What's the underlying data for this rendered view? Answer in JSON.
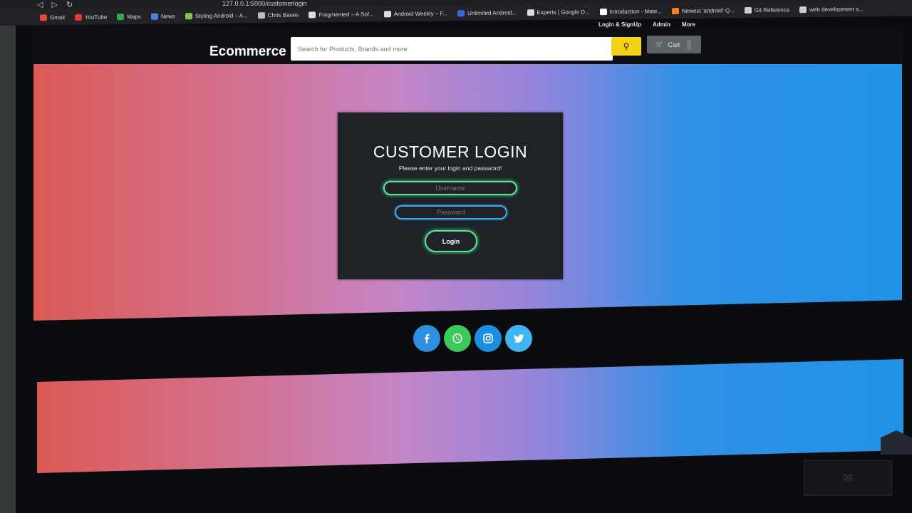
{
  "browser": {
    "address": "127.0.0.1:5000/customerlogin",
    "bookmarks": [
      {
        "label": "Gmail",
        "color": "#e04b3c"
      },
      {
        "label": "YouTube",
        "color": "#e53935"
      },
      {
        "label": "Maps",
        "color": "#34a853"
      },
      {
        "label": "News",
        "color": "#4a7fe0"
      },
      {
        "label": "Styling Android – A...",
        "color": "#8bc34a"
      },
      {
        "label": "Chris Banes",
        "color": "#bbbbbb"
      },
      {
        "label": "Fragmented – A Sof...",
        "color": "#dddddd"
      },
      {
        "label": "Android Weekly – F...",
        "color": "#dddddd"
      },
      {
        "label": "Unlimited Android...",
        "color": "#2f6bd6"
      },
      {
        "label": "Experts | Google D...",
        "color": "#dddddd"
      },
      {
        "label": "Introduction - Mate...",
        "color": "#ffffff"
      },
      {
        "label": "Newest 'android' Q...",
        "color": "#f48024"
      },
      {
        "label": "Git Reference",
        "color": "#cccccc"
      },
      {
        "label": "web development s...",
        "color": "#cccccc"
      }
    ]
  },
  "header": {
    "brand": "Ecommerce",
    "links": {
      "login_signup": "Login & SignUp",
      "admin": "Admin",
      "more": "More"
    },
    "search_placeholder": "Search for Products, Brands and more",
    "cart_label": "Cart"
  },
  "login": {
    "title": "CUSTOMER LOGIN",
    "subtitle": "Please enter your login and password!",
    "username_placeholder": "Username",
    "password_placeholder": "Password",
    "button_label": "Login"
  },
  "social": [
    {
      "name": "facebook-icon",
      "glyph": "f",
      "color": "#2d8fe0"
    },
    {
      "name": "whatsapp-icon",
      "glyph": "☎",
      "color": "#3ccb5a"
    },
    {
      "name": "instagram-icon",
      "glyph": "◎",
      "color": "#1a8fe0"
    },
    {
      "name": "twitter-icon",
      "glyph": "❖",
      "color": "#3fb6f0"
    }
  ],
  "colors": {
    "accent_yellow": "#f3d21a",
    "neon_green": "#5fe39b",
    "neon_blue": "#47a8e6"
  }
}
